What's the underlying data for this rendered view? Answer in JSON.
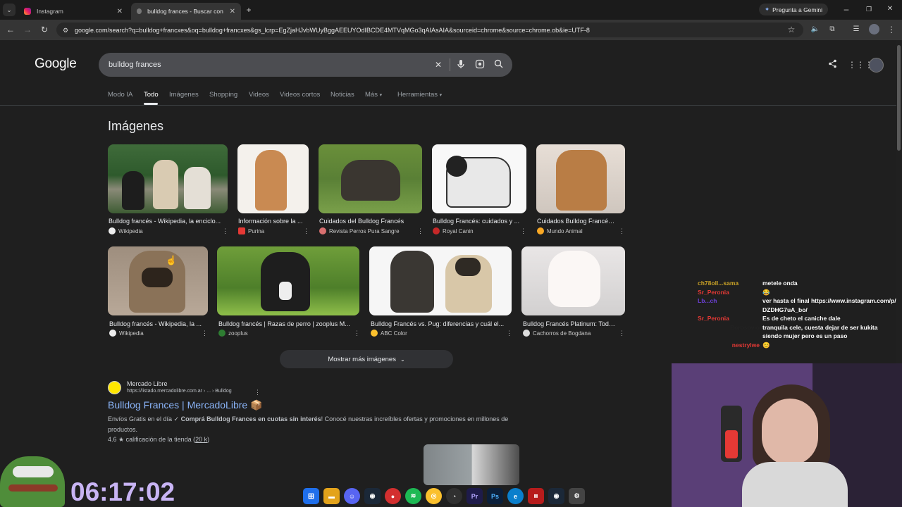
{
  "browser": {
    "tabs": [
      {
        "title": "Instagram",
        "active": false
      },
      {
        "title": "bulldog frances - Buscar con Go",
        "active": true
      }
    ],
    "gemini_label": "Pregunta a Gemini",
    "url": "google.com/search?q=bulldog+francxes&oq=bulldog+francxes&gs_lcrp=EgZjaHJvbWUyBggAEEUYOdIBCDE4MTVqMGo3qAIAsAIA&sourceid=chrome&source=chrome.ob&ie=UTF-8"
  },
  "google": {
    "logo": "Google",
    "query": "bulldog frances",
    "nav_tabs": [
      "Modo IA",
      "Todo",
      "Imágenes",
      "Shopping",
      "Videos",
      "Videos cortos",
      "Noticias",
      "Más",
      "Herramientas"
    ],
    "active_tab": "Todo",
    "images_heading": "Imágenes",
    "images_row1": [
      {
        "title": "Bulldog francés - Wikipedia, la enciclo...",
        "source": "Wikipedia"
      },
      {
        "title": "Información sobre la ...",
        "source": "Purina"
      },
      {
        "title": "Cuidados del Bulldog Francés",
        "source": "Revista Perros Pura Sangre"
      },
      {
        "title": "Bulldog Francés: cuidados y ...",
        "source": "Royal Canin"
      },
      {
        "title": "Cuidados Bulldog Francés ...",
        "source": "Mundo Animal"
      }
    ],
    "images_row2": [
      {
        "title": "Bulldog francés - Wikipedia, la ...",
        "source": "Wikipedia"
      },
      {
        "title": "Bulldog francés | Razas de perro | zooplus M...",
        "source": "zooplus"
      },
      {
        "title": "Bulldog Francés vs. Pug: diferencias y cuál el...",
        "source": "ABC Color"
      },
      {
        "title": "Bulldog Francés Platinum: Todo ...",
        "source": "Cachorros de Bogdana"
      }
    ],
    "more_images": "Mostrar más imágenes",
    "result": {
      "site": "Mercado Libre",
      "url": "https://listado.mercadolibre.com.ar › ... › Bulldog",
      "title": "Bulldog Frances | MercadoLibre 📦",
      "snippet_pre": "Envíos Gratis en el día ✓ ",
      "snippet_bold": "Comprá Bulldog Frances en cuotas sin interés",
      "snippet_post": "! Conocé nuestras increíbles ofertas y promociones en millones de productos.",
      "rating": "4.6 ★ calificación de la tienda (",
      "rating_link": "20 k",
      "rating_end": ")"
    }
  },
  "stream": {
    "timer": "06:17:02",
    "chat": [
      {
        "user": "ch78oll...sama",
        "text": "metele onda"
      },
      {
        "user": "Sr_Peronia",
        "text": "😂"
      },
      {
        "user": "Lb...ch",
        "text": "ver hasta el final https://www.instagram.com/p/DZDHG7uA_bo/"
      },
      {
        "user": "Sr_Peronia",
        "text": "Es de cheto el caniche dale"
      },
      {
        "user": "Borosovio",
        "text": "tranquila cele, cuesta dejar de ser kukita siendo mujer pero es un paso"
      },
      {
        "user": "nestrylwe",
        "text": "😊"
      }
    ]
  },
  "taskbar_icons": [
    "windows-start",
    "file-explorer",
    "discord",
    "steam",
    "app-red",
    "spotify",
    "chrome",
    "obs",
    "premiere",
    "photoshop",
    "edge",
    "app-news",
    "steam-2",
    "settings"
  ],
  "colors": {
    "link": "#8ab4f8",
    "page_bg": "#1f1f1f",
    "timer": "#c8b4f4"
  }
}
